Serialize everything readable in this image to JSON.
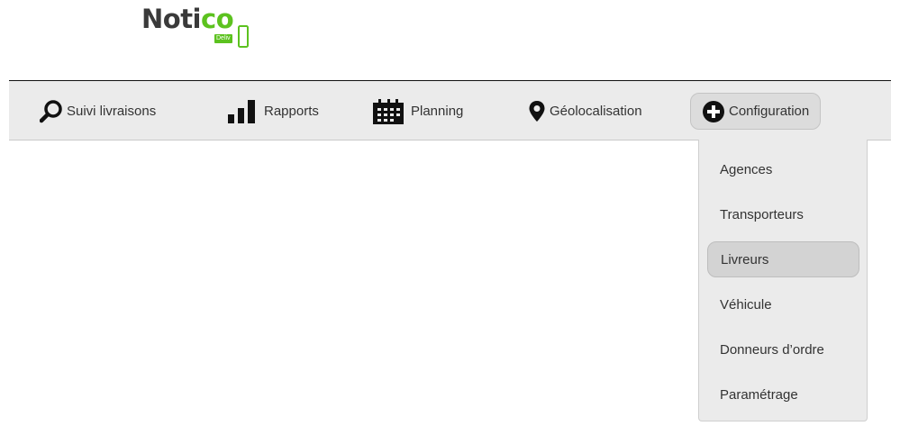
{
  "logo": {
    "text_dark": "Noti",
    "text_green": "co",
    "badge": "Deliv"
  },
  "nav": {
    "items": [
      {
        "label": "Suivi livraisons",
        "icon": "search-icon"
      },
      {
        "label": "Rapports",
        "icon": "bar-chart-icon"
      },
      {
        "label": "Planning",
        "icon": "calendar-icon"
      },
      {
        "label": "Géolocalisation",
        "icon": "map-pin-icon"
      },
      {
        "label": "Configuration",
        "icon": "plus-circle-icon",
        "active": true
      }
    ]
  },
  "dropdown": {
    "items": [
      {
        "label": "Agences"
      },
      {
        "label": "Transporteurs"
      },
      {
        "label": "Livreurs",
        "selected": true
      },
      {
        "label": "Véhicule"
      },
      {
        "label": "Donneurs d’ordre"
      },
      {
        "label": "Paramétrage"
      }
    ]
  },
  "colors": {
    "brand_green": "#5cc21f",
    "navbar_bg": "#ebebeb",
    "text": "#333333",
    "active_bg": "#dcdcdc"
  }
}
